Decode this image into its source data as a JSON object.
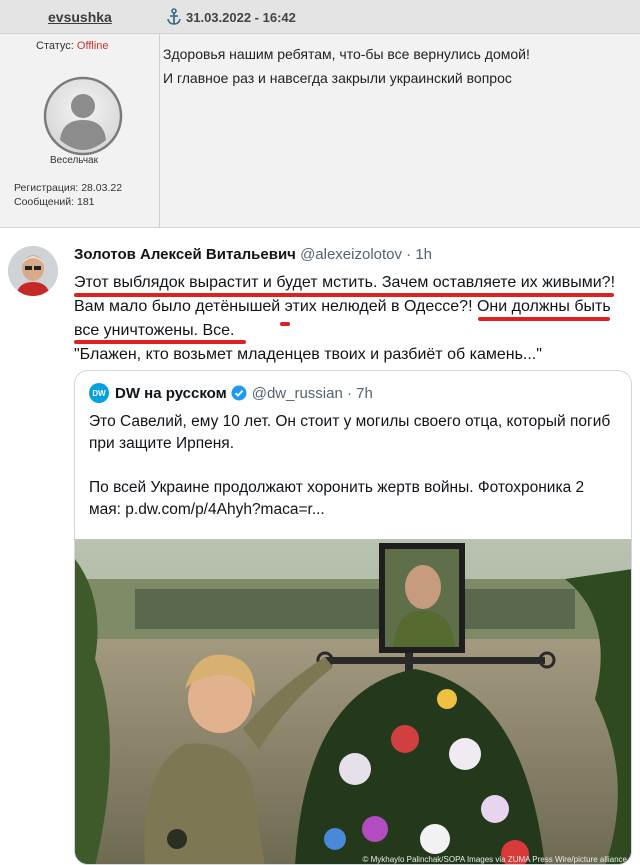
{
  "forum": {
    "username": "evsushka",
    "datetime": "31.03.2022 - 16:42",
    "status_label": "Статус:",
    "status_value": "Offline",
    "rank": "Весельчак",
    "registration": "Регистрация: 28.03.22",
    "messages": "Сообщений: 181",
    "post_lines": [
      "Здоровья нашим ребятам, что-бы все вернулись домой!",
      "И главное раз и навсегда закрыли украинский вопрос"
    ]
  },
  "tweet": {
    "author_name": "Золотов Алексей Витальевич",
    "author_handle": "@alexeizolotov · 1h",
    "lines": [
      "Этот выблядок вырастит и будет мстить. Зачем оставляете их живыми?!",
      "Вам мало было детёнышей этих нелюдей в Одессе?! Они должны быть",
      "все уничтожены. Все.",
      "\"Блажен, кто возьмет младенцев твоих и разбиёт об камень...\""
    ],
    "quote": {
      "logo_text": "DW",
      "name": "DW на русском",
      "handle": "@dw_russian · 7h",
      "para1": "Это Савелий, ему 10 лет. Он стоит у могилы своего отца, который погиб при защите Ирпеня.",
      "para2": "По всей Украине продолжают хоронить жертв войны. Фотохроника 2 мая: p.dw.com/p/4Ahyh?maca=r...",
      "photo_credit": "© Mykhaylo Palinchak/SOPA Images via ZUMA Press Wire/picture alliance"
    }
  },
  "colors": {
    "offline": "#cc3333",
    "underline": "#e02020",
    "dw_blue": "#05a0e0",
    "verified_blue": "#1d9bf0"
  }
}
